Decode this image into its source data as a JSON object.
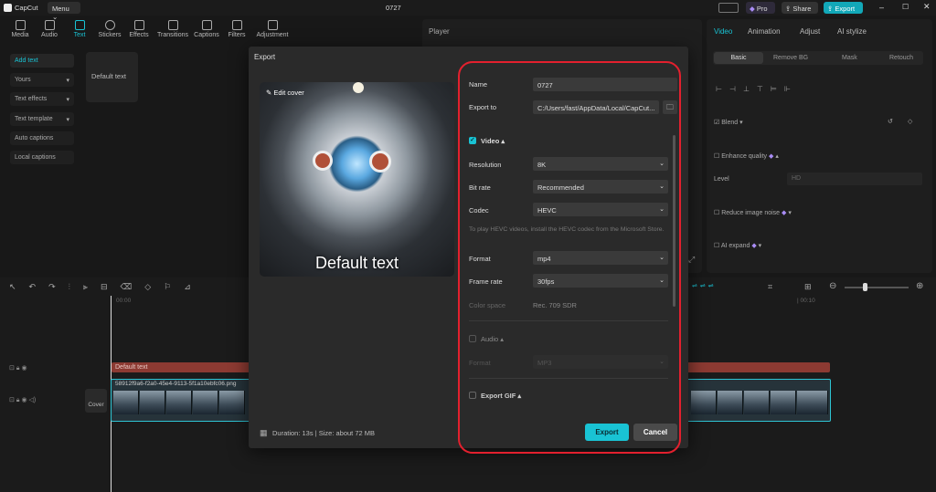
{
  "app": {
    "logo": "CapCut",
    "menu_label": "Menu",
    "project_title": "0727",
    "pro_label": "Pro",
    "share_label": "Share",
    "export_label": "Export"
  },
  "toolbar": {
    "items": [
      {
        "label": "Media",
        "icon": "media-icon"
      },
      {
        "label": "Audio",
        "icon": "audio-icon"
      },
      {
        "label": "Text",
        "icon": "text-icon"
      },
      {
        "label": "Stickers",
        "icon": "stickers-icon"
      },
      {
        "label": "Effects",
        "icon": "effects-icon"
      },
      {
        "label": "Transitions",
        "icon": "transitions-icon"
      },
      {
        "label": "Captions",
        "icon": "captions-icon"
      },
      {
        "label": "Filters",
        "icon": "filters-icon"
      },
      {
        "label": "Adjustment",
        "icon": "adjustment-icon"
      }
    ],
    "active": "Text"
  },
  "left_nav": [
    "Add text",
    "Yours",
    "Text effects",
    "Text template",
    "Auto captions",
    "Local captions"
  ],
  "text_preset": "Default text",
  "player": {
    "title": "Player"
  },
  "right_panel": {
    "tabs": [
      "Video",
      "Animation",
      "Adjust",
      "AI stylize"
    ],
    "subtabs": [
      "Basic",
      "Remove BG",
      "Mask",
      "Retouch"
    ],
    "blend_label": "Blend",
    "enhance_label": "Enhance quality",
    "level_label": "Level",
    "level_value": "HD",
    "reduce_noise_label": "Reduce image noise",
    "ai_expand_label": "AI expand"
  },
  "timeline": {
    "start_time": "00:00",
    "end_time": "| 00:10",
    "text_clip": "Default text",
    "video_clip": "58912f9a6-f2a0-45e4-9113-5f1a10ebfc06.png",
    "cover_label": "Cover"
  },
  "export_dialog": {
    "title": "Export",
    "edit_cover": "Edit cover",
    "preview_overlay": "Default text",
    "duration_info": "Duration: 13s | Size: about 72 MB",
    "name_label": "Name",
    "name_value": "0727",
    "export_to_label": "Export to",
    "export_to_value": "C:/Users/fast/AppData/Local/CapCut...",
    "video_section": "Video",
    "resolution_label": "Resolution",
    "resolution_value": "8K",
    "bitrate_label": "Bit rate",
    "bitrate_value": "Recommended",
    "codec_label": "Codec",
    "codec_value": "HEVC",
    "codec_note": "To play HEVC videos, install the HEVC codec from the Microsoft Store.",
    "format_label": "Format",
    "format_value": "mp4",
    "framerate_label": "Frame rate",
    "framerate_value": "30fps",
    "colorspace_label": "Color space",
    "colorspace_value": "Rec. 709 SDR",
    "audio_section": "Audio",
    "audio_format_label": "Format",
    "audio_format_value": "MP3",
    "gif_section": "Export GIF",
    "export_button": "Export",
    "cancel_button": "Cancel"
  },
  "colors": {
    "accent": "#19c3d4",
    "highlight_border": "#e3202e",
    "text_clip": "#8c3a32",
    "video_clip_border": "#2ec4d4"
  }
}
